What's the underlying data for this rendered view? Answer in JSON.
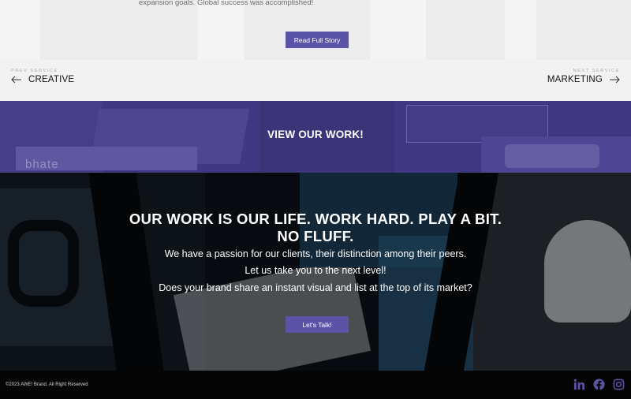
{
  "story": {
    "excerpt": "expansion goals. Global success was accomplished!",
    "read_button": "Read Full Story"
  },
  "service_nav": {
    "prev_tag": "PREV SERVICE",
    "prev_name": "CREATIVE",
    "next_tag": "NEXT SERVICE",
    "next_name": "MARKETING"
  },
  "view_work": {
    "title": "VIEW OUR WORK!",
    "watermark": "bhate"
  },
  "hero": {
    "headline_line1": "OUR WORK IS OUR LIFE. WORK HARD. PLAY A BIT.",
    "headline_line2": "NO FLUFF.",
    "line1": "We have a passion for our clients, their distinction among their peers.",
    "line2": "Let us take you to the next level!",
    "line3": "Does your brand share an instant visual and list at the top of its market?",
    "button": "Let's Talk!"
  },
  "footer": {
    "copyright": "©2023 AWE! Brand. All Right Reserved",
    "social": [
      "linkedin-icon",
      "facebook-icon",
      "instagram-icon"
    ]
  },
  "colors": {
    "accent": "#5b54a6",
    "social": "#5b54a6",
    "nav_bg": "#f2f2f2",
    "footer_bg": "#050505"
  }
}
